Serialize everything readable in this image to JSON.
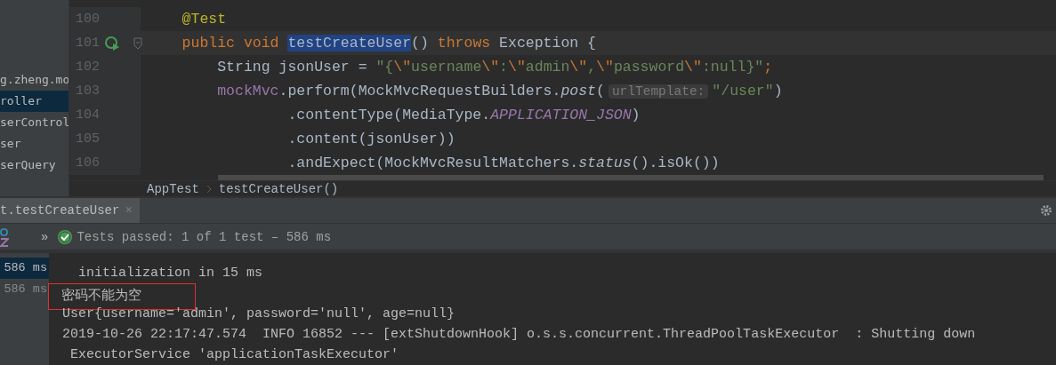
{
  "project_tree": {
    "items": [
      {
        "label": "g.zheng.mo",
        "selected": false
      },
      {
        "label": "roller",
        "selected": true
      },
      {
        "label": "serControl",
        "selected": false
      },
      {
        "label": "ser",
        "selected": false
      },
      {
        "label": "serQuery",
        "selected": false
      }
    ]
  },
  "editor": {
    "lines": [
      {
        "number": "100",
        "run_icon": false,
        "current": false,
        "tokens": [
          {
            "t": "    @Test",
            "kind": "annotation"
          }
        ]
      },
      {
        "number": "101",
        "run_icon": true,
        "current": true,
        "tokens": [
          {
            "t": "    public void ",
            "kind": "keyword"
          },
          {
            "t": "testCreateUser",
            "kind": "selection"
          },
          {
            "t": "() ",
            "kind": "plain"
          },
          {
            "t": "throws",
            "kind": "keyword"
          },
          {
            "t": " Exception {",
            "kind": "plain"
          }
        ]
      },
      {
        "number": "102",
        "run_icon": false,
        "current": false,
        "tokens": [
          {
            "t": "        String jsonUser = ",
            "kind": "plain"
          },
          {
            "t": "\"{",
            "kind": "string"
          },
          {
            "t": "\\\"",
            "kind": "escape"
          },
          {
            "t": "username",
            "kind": "string"
          },
          {
            "t": "\\\"",
            "kind": "escape"
          },
          {
            "t": ":",
            "kind": "string"
          },
          {
            "t": "\\\"",
            "kind": "escape"
          },
          {
            "t": "admin",
            "kind": "string"
          },
          {
            "t": "\\\"",
            "kind": "escape"
          },
          {
            "t": ",",
            "kind": "string"
          },
          {
            "t": "\\\"",
            "kind": "escape"
          },
          {
            "t": "password",
            "kind": "string"
          },
          {
            "t": "\\\"",
            "kind": "escape"
          },
          {
            "t": ":null}\"",
            "kind": "string"
          },
          {
            "t": ";",
            "kind": "keyword"
          }
        ]
      },
      {
        "number": "103",
        "run_icon": false,
        "current": false,
        "tokens": [
          {
            "t": "        mockMvc",
            "kind": "field"
          },
          {
            "t": ".perform(MockMvcRequestBuilders.",
            "kind": "plain"
          },
          {
            "t": "post",
            "kind": "static"
          },
          {
            "t": "(",
            "kind": "plain"
          },
          {
            "t": "urlTemplate:",
            "kind": "hint"
          },
          {
            "t": "\"/user\"",
            "kind": "string"
          },
          {
            "t": ")",
            "kind": "plain"
          }
        ]
      },
      {
        "number": "104",
        "run_icon": false,
        "current": false,
        "tokens": [
          {
            "t": "                .contentType(MediaType.",
            "kind": "plain"
          },
          {
            "t": "APPLICATION_JSON",
            "kind": "constant"
          },
          {
            "t": ")",
            "kind": "plain"
          }
        ]
      },
      {
        "number": "105",
        "run_icon": false,
        "current": false,
        "tokens": [
          {
            "t": "                .content(jsonUser))",
            "kind": "plain"
          }
        ]
      },
      {
        "number": "106",
        "run_icon": false,
        "current": false,
        "tokens": [
          {
            "t": "                .andExpect(MockMvcResultMatchers.",
            "kind": "plain"
          },
          {
            "t": "status",
            "kind": "static"
          },
          {
            "t": "().isOk())",
            "kind": "plain"
          }
        ]
      }
    ],
    "breadcrumbs": [
      "AppTest",
      "testCreateUser()"
    ]
  },
  "run_panel": {
    "tabs": [
      {
        "label": "t.testCreateUser",
        "selected": true,
        "close": "×"
      }
    ],
    "expand_glyph": "»",
    "status": {
      "passed": true,
      "text": "Tests passed: 1 of 1 test – 586 ms"
    },
    "tree": [
      {
        "duration": "586 ms",
        "selected": true
      },
      {
        "duration": "586 ms",
        "selected": false
      }
    ],
    "console": [
      {
        "text": "  initialization in 15 ms",
        "highlighted": false
      },
      {
        "text": "密码不能为空",
        "highlighted": true
      },
      {
        "text": "User{username='admin', password='null', age=null}",
        "highlighted": false
      },
      {
        "text": "2019-10-26 22:17:47.574  INFO 16852 --- [extShutdownHook] o.s.s.concurrent.ThreadPoolTaskExecutor  : Shutting down",
        "highlighted": false
      },
      {
        "text": " ExecutorService 'applicationTaskExecutor'",
        "highlighted": false
      }
    ]
  }
}
